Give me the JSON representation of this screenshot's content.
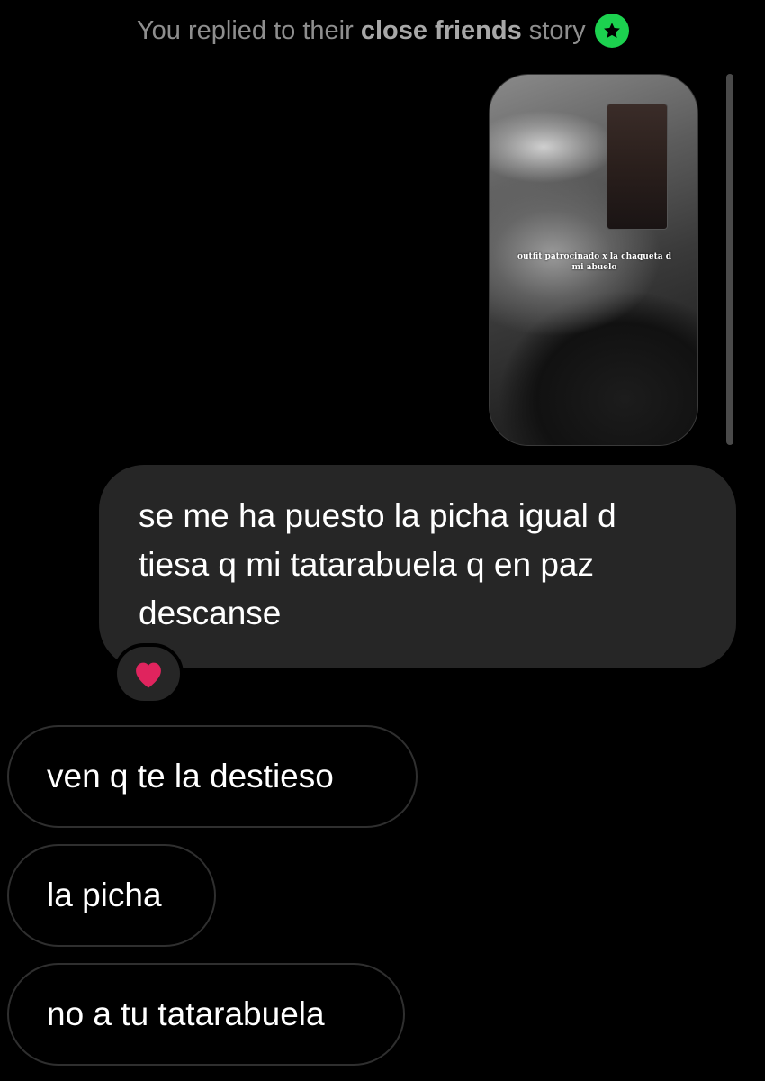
{
  "header": {
    "context_prefix": "You replied to their",
    "context_bold": "close friends",
    "context_suffix": "story",
    "badge_icon": "star-icon",
    "badge_color": "#1cd14f"
  },
  "story": {
    "caption_line1": "outfit patrocinado x la chaqueta d",
    "caption_line2": "mi abuelo"
  },
  "messages": {
    "sent": [
      {
        "lines": [
          "se me ha puesto la picha igual d",
          "tiesa q mi tatarabuela q en paz",
          "descanse"
        ],
        "reaction_icon": "heart-icon"
      }
    ],
    "received": [
      {
        "text": "ven q te la destieso"
      },
      {
        "text": "la picha"
      },
      {
        "text": "no a tu tatarabuela"
      }
    ]
  },
  "colors": {
    "background": "#000000",
    "sent_bubble": "#262626",
    "received_border": "#2f2f2f",
    "reaction_heart": "#e0245e"
  }
}
